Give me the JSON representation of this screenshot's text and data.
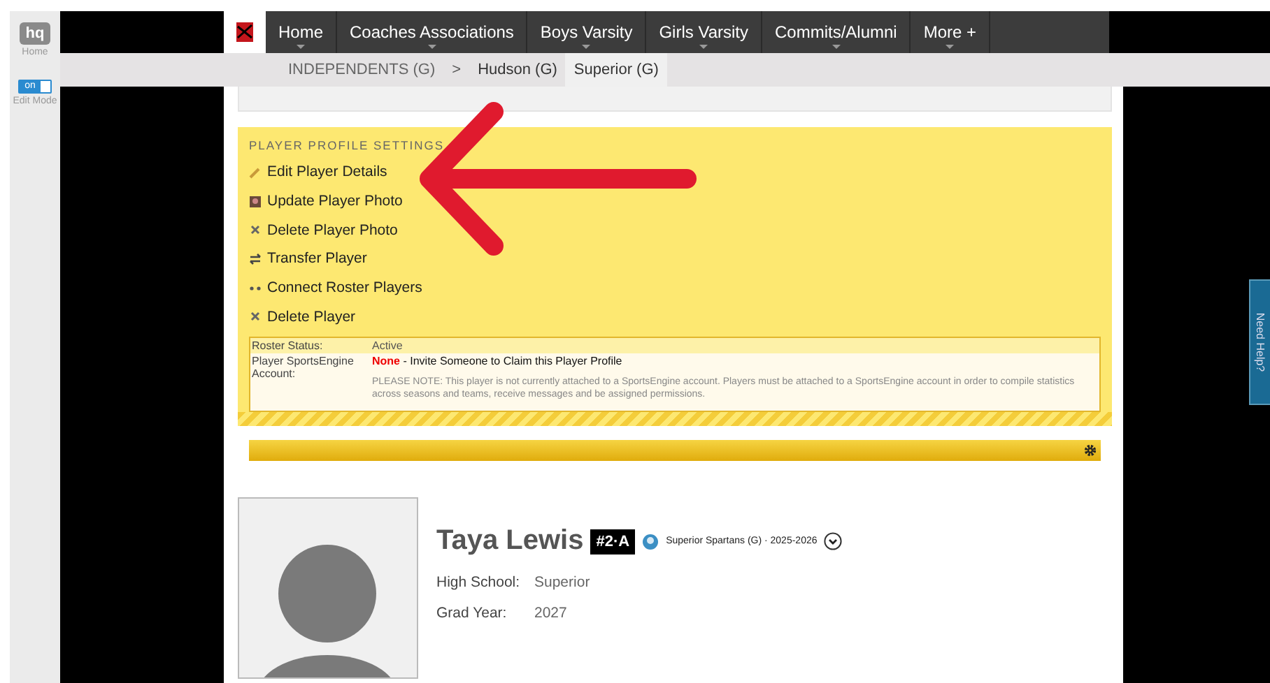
{
  "sidebar": {
    "logo": "hq",
    "home_label": "Home",
    "edit_toggle": {
      "label": "on",
      "on": true
    },
    "edit_label": "Edit Mode"
  },
  "nav": {
    "items": [
      {
        "label": "Home"
      },
      {
        "label": "Coaches Associations"
      },
      {
        "label": "Boys Varsity"
      },
      {
        "label": "Girls Varsity"
      },
      {
        "label": "Commits/Alumni"
      },
      {
        "label": "More +"
      }
    ]
  },
  "breadcrumb": {
    "root": "INDEPENDENTS (G)",
    "separator": ">",
    "items": [
      {
        "label": "Hudson (G)",
        "selected": false
      },
      {
        "label": "Superior (G)",
        "selected": true
      }
    ]
  },
  "settings": {
    "title": "PLAYER PROFILE SETTINGS",
    "actions": [
      {
        "label": "Edit Player Details",
        "kind": "edit"
      },
      {
        "label": "Update Player Photo",
        "kind": "photo"
      },
      {
        "label": "Delete Player Photo",
        "kind": "delete"
      },
      {
        "label": "Transfer Player",
        "kind": "transfer"
      },
      {
        "label": "Connect Roster Players",
        "kind": "connect"
      },
      {
        "label": "Delete Player",
        "kind": "delete"
      }
    ],
    "info": {
      "status_label": "Roster Status:",
      "status_value": "Active",
      "account_label": "Player SportsEngine Account:",
      "account_status": "None",
      "invite_link": "- Invite Someone to Claim this Player Profile",
      "note": "PLEASE NOTE: This player is not currently attached to a SportsEngine account. Players must be attached to a SportsEngine account in order to compile statistics across seasons and teams, receive messages and be assigned permissions."
    }
  },
  "profile": {
    "name": "Taya Lewis",
    "number": "#2·A",
    "team": "Superior Spartans (G) · 2025-2026",
    "fields": [
      {
        "label": "High School:",
        "value": "Superior"
      },
      {
        "label": "Grad Year:",
        "value": "2027"
      }
    ]
  },
  "help_tab": "Need Help?"
}
